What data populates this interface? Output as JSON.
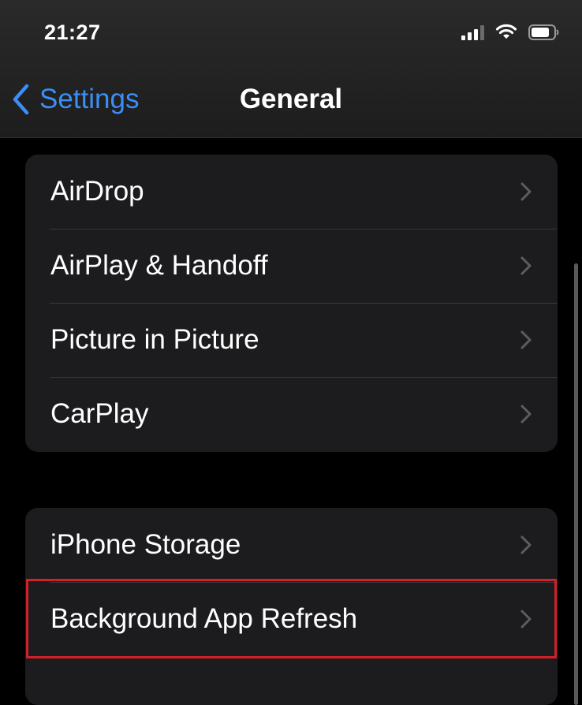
{
  "status_bar": {
    "time": "21:27",
    "icons": [
      "signal-icon",
      "wifi-icon",
      "battery-icon"
    ]
  },
  "nav": {
    "back_label": "Settings",
    "title": "General"
  },
  "groups": [
    {
      "items": [
        {
          "label": "AirDrop"
        },
        {
          "label": "AirPlay & Handoff"
        },
        {
          "label": "Picture in Picture"
        },
        {
          "label": "CarPlay"
        }
      ]
    },
    {
      "items": [
        {
          "label": "iPhone Storage"
        },
        {
          "label": "Background App Refresh"
        }
      ]
    }
  ],
  "highlighted_item": "Background App Refresh",
  "colors": {
    "accent": "#3a8ef6",
    "background": "#000000",
    "cell": "#1c1c1e",
    "highlight_border": "#d0202a"
  }
}
